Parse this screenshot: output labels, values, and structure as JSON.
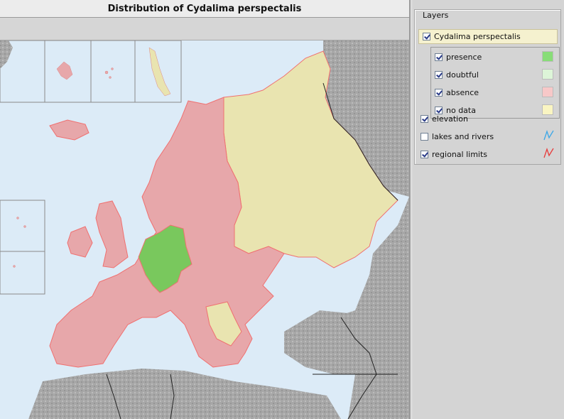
{
  "map": {
    "title": "Distribution of Cydalima perspectalis",
    "colors": {
      "sea": "#dcebf7",
      "relief": "#a9a9a9",
      "presence": "#79c85d",
      "absence": "#e7a7aa",
      "no_data": "#e9e4b0",
      "regional_limit": "#f07070",
      "border": "#222222"
    }
  },
  "layers": {
    "group_label": "Layers",
    "species": {
      "label": "Cydalima perspectalis",
      "checked": true
    },
    "legend": [
      {
        "label": "presence",
        "checked": true,
        "color": "#88dd77"
      },
      {
        "label": "doubtful",
        "checked": true,
        "color": "#ddf5d8"
      },
      {
        "label": "absence",
        "checked": true,
        "color": "#f7c8c8"
      },
      {
        "label": "no data",
        "checked": true,
        "color": "#faf5c2"
      }
    ],
    "others": [
      {
        "label": "elevation",
        "checked": true,
        "icon": "none"
      },
      {
        "label": "lakes and rivers",
        "checked": false,
        "icon": "blue-line-icon"
      },
      {
        "label": "regional limits",
        "checked": true,
        "icon": "red-line-icon"
      }
    ]
  }
}
